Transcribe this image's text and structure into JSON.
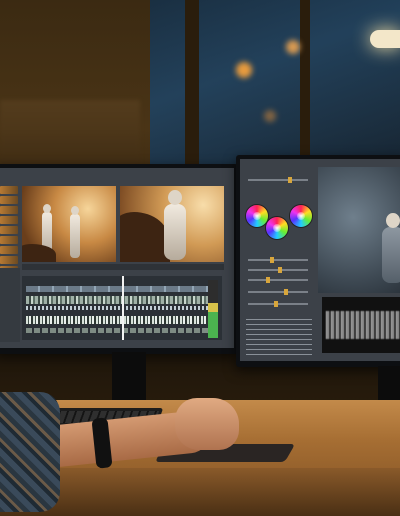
{
  "scene": {
    "description_tags": [
      "video-editing-workstation",
      "dual-monitors",
      "color-grading"
    ],
    "colors": {
      "warm_light": "#c88944",
      "desk_wood": "#a66e33",
      "screen_ui": "#3c4148",
      "night_window": "#1d4467"
    }
  },
  "left_monitor": {
    "icons": [
      "media-bin-icon",
      "timeline-icon",
      "audio-meter-icon"
    ]
  },
  "right_monitor": {
    "icons": [
      "color-wheel-icon",
      "waveform-scope-icon"
    ]
  }
}
